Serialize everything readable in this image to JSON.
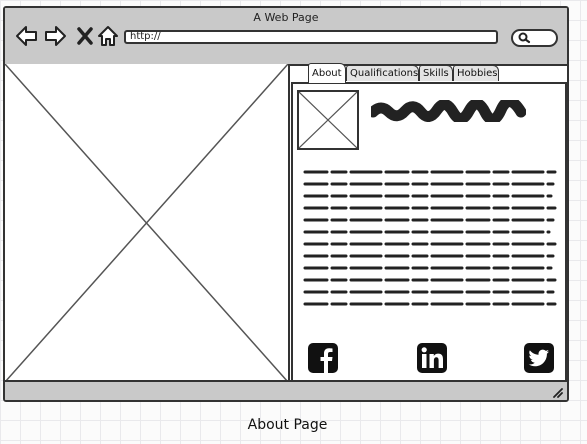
{
  "window": {
    "title": "A Web Page"
  },
  "toolbar": {
    "back_icon": "arrow-left-icon",
    "forward_icon": "arrow-right-icon",
    "stop_icon": "close-icon",
    "home_icon": "home-icon",
    "url": "http://",
    "search_icon": "search-icon"
  },
  "tabs": [
    {
      "label": "About",
      "active": true
    },
    {
      "label": "Qualifications",
      "active": false
    },
    {
      "label": "Skills",
      "active": false
    },
    {
      "label": "Hobbies",
      "active": false
    }
  ],
  "social": [
    {
      "icon": "facebook-icon"
    },
    {
      "icon": "linkedin-icon"
    },
    {
      "icon": "twitter-icon"
    }
  ],
  "caption": "About Page"
}
